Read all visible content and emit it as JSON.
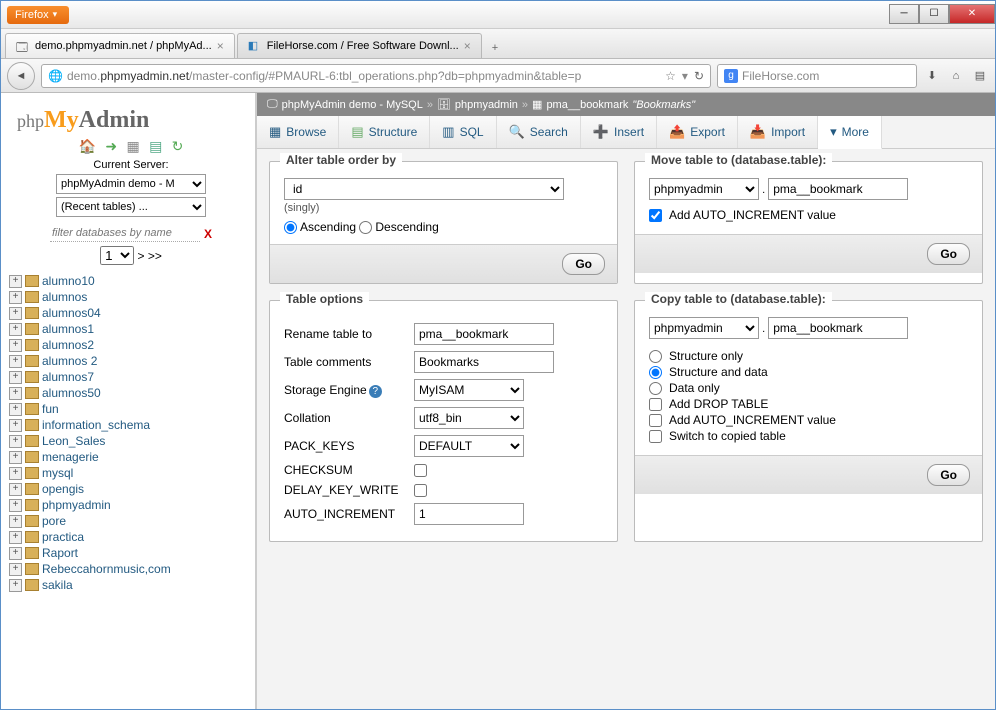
{
  "window": {
    "firefox_label": "Firefox",
    "tabs": [
      {
        "label": "demo.phpmyadmin.net / phpMyAd..."
      },
      {
        "label": "FileHorse.com / Free Software Downl..."
      }
    ],
    "url_prefix": "demo.",
    "url_domain": "phpmyadmin.net",
    "url_path": "/master-config/#PMAURL-6:tbl_operations.php?db=phpmyadmin&table=p",
    "search_placeholder": "FileHorse.com"
  },
  "sidebar": {
    "current_server_label": "Current Server:",
    "server_select": "phpMyAdmin demo - M",
    "recent_select": "(Recent tables) ...",
    "filter_placeholder": "filter databases by name",
    "page_select": "1",
    "pager_next": "> >>",
    "databases": [
      "alumno10",
      "alumnos",
      "alumnos04",
      "alumnos1",
      "alumnos2",
      "alumnos 2",
      "alumnos7",
      "alumnos50",
      "fun",
      "information_schema",
      "Leon_Sales",
      "menagerie",
      "mysql",
      "opengis",
      "phpmyadmin",
      "pore",
      "practica",
      "Raport",
      "Rebeccahornmusic,com",
      "sakila"
    ]
  },
  "breadcrumb": {
    "server": "phpMyAdmin demo - MySQL",
    "db": "phpmyadmin",
    "table": "pma__bookmark",
    "comment": "\"Bookmarks\""
  },
  "toptabs": {
    "browse": "Browse",
    "structure": "Structure",
    "sql": "SQL",
    "search": "Search",
    "insert": "Insert",
    "export": "Export",
    "import": "Import",
    "more": "More"
  },
  "alter": {
    "legend": "Alter table order by",
    "column": "id",
    "singly": "(singly)",
    "asc": "Ascending",
    "desc": "Descending",
    "go": "Go"
  },
  "move": {
    "legend": "Move table to (database.table):",
    "db": "phpmyadmin",
    "table": "pma__bookmark",
    "auto_inc": "Add AUTO_INCREMENT value",
    "go": "Go"
  },
  "options": {
    "legend": "Table options",
    "rename_lbl": "Rename table to",
    "rename_val": "pma__bookmark",
    "comments_lbl": "Table comments",
    "comments_val": "Bookmarks",
    "engine_lbl": "Storage Engine",
    "engine_val": "MyISAM",
    "collation_lbl": "Collation",
    "collation_val": "utf8_bin",
    "pack_lbl": "PACK_KEYS",
    "pack_val": "DEFAULT",
    "checksum_lbl": "CHECKSUM",
    "delay_lbl": "DELAY_KEY_WRITE",
    "autoinc_lbl": "AUTO_INCREMENT",
    "autoinc_val": "1"
  },
  "copy": {
    "legend": "Copy table to (database.table):",
    "db": "phpmyadmin",
    "table": "pma__bookmark",
    "structure_only": "Structure only",
    "structure_data": "Structure and data",
    "data_only": "Data only",
    "drop": "Add DROP TABLE",
    "auto_inc": "Add AUTO_INCREMENT value",
    "switch": "Switch to copied table",
    "go": "Go"
  }
}
